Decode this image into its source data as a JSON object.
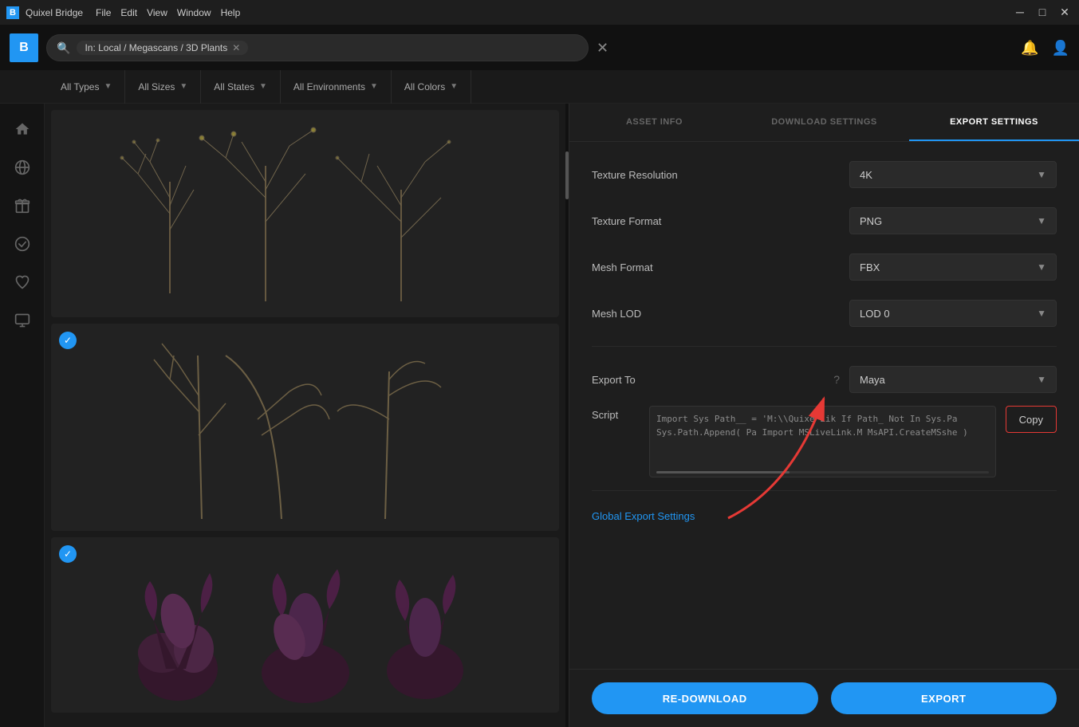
{
  "titlebar": {
    "icon": "B",
    "title": "Quixel Bridge",
    "menu": [
      "File",
      "Edit",
      "View",
      "Window",
      "Help"
    ],
    "controls": [
      "─",
      "□",
      "✕"
    ]
  },
  "header": {
    "logo": "B",
    "search": {
      "tag": "In: Local / Megascans / 3D Plants",
      "placeholder": ""
    }
  },
  "filters": [
    {
      "label": "All Types"
    },
    {
      "label": "All Sizes"
    },
    {
      "label": "All States"
    },
    {
      "label": "All Environments"
    },
    {
      "label": "All Colors"
    }
  ],
  "sidebar": {
    "items": [
      {
        "name": "home-icon",
        "symbol": "⌂"
      },
      {
        "name": "globe-icon",
        "symbol": "○"
      },
      {
        "name": "gift-icon",
        "symbol": "⊡"
      },
      {
        "name": "check-circle-icon",
        "symbol": "◎"
      },
      {
        "name": "heart-icon",
        "symbol": "♡"
      },
      {
        "name": "monitor-icon",
        "symbol": "▭"
      }
    ]
  },
  "panel": {
    "tabs": [
      {
        "label": "ASSET INFO",
        "active": false
      },
      {
        "label": "DOWNLOAD SETTINGS",
        "active": false
      },
      {
        "label": "EXPORT SETTINGS",
        "active": true
      }
    ],
    "settings": [
      {
        "label": "Texture Resolution",
        "value": "4K"
      },
      {
        "label": "Texture Format",
        "value": "PNG"
      },
      {
        "label": "Mesh Format",
        "value": "FBX"
      },
      {
        "label": "Mesh LOD",
        "value": "LOD 0"
      }
    ],
    "export_to": {
      "label": "Export To",
      "value": "Maya"
    },
    "script": {
      "label": "Script",
      "content": "Import Sys\nPath__ = 'M:\\\\Quixe Lik\nIf Path_ Not In Sys.Pa\n  Sys.Path.Append( Pa\nImport MSLiveLink.M\nMsAPI.CreateMSshe )"
    },
    "copy_button": "Copy",
    "global_export": "Global Export Settings",
    "actions": {
      "redownload": "RE-DOWNLOAD",
      "export": "EXPORT"
    }
  },
  "assets": [
    {
      "checked": false,
      "type": "plant-sparse"
    },
    {
      "checked": true,
      "type": "plant-tall"
    },
    {
      "checked": true,
      "type": "plant-dark"
    }
  ],
  "colors": {
    "accent": "#2196f3",
    "copy_border": "#e53935",
    "bg_dark": "#1a1a1a",
    "bg_panel": "#1e1e1e"
  }
}
